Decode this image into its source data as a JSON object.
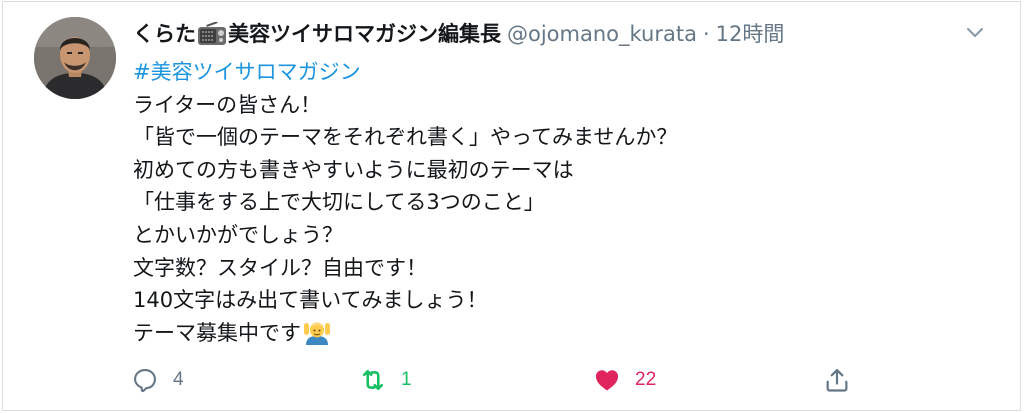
{
  "tweet": {
    "display_name": "くらた",
    "display_name_suffix": "美容ツイサロマガジン編集長",
    "handle": "@ojomano_kurata",
    "separator": "·",
    "timestamp": "12時間",
    "body_lines": [
      "#美容ツイサロマガジン",
      "ライターの皆さん！",
      "「皆で一個のテーマをそれぞれ書く」やってみませんか？",
      "初めての方も書きやすいように最初のテーマは",
      "「仕事をする上で大切にしてる3つのこと」",
      "とかいかがでしょう？",
      "文字数？スタイル？自由です！",
      "140文字はみ出て書いてみましょう！",
      "テーマ募集中です"
    ],
    "hashtag_color": "#1b95e0"
  },
  "actions": {
    "reply": {
      "icon": "reply-icon",
      "count": "4"
    },
    "retweet": {
      "icon": "retweet-icon",
      "count": "1",
      "color": "#17bf63"
    },
    "like": {
      "icon": "heart-icon",
      "count": "22",
      "color": "#e0245e"
    },
    "share": {
      "icon": "share-icon"
    }
  },
  "icons": {
    "radio": "radio-emoji-icon",
    "raising_hands": "person-raising-hands-emoji-icon",
    "menu": "chevron-down-icon"
  }
}
